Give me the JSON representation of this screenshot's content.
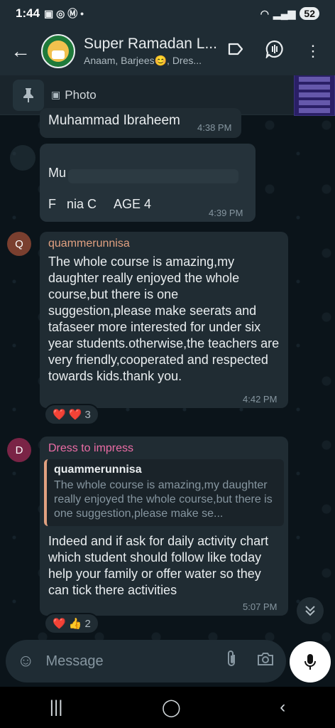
{
  "status_bar": {
    "time": "1:44",
    "battery": "52"
  },
  "header": {
    "title": "Super Ramadan L...",
    "subtitle": "Anaam, Barjees😊, Dres..."
  },
  "pinned": {
    "label": "Photo"
  },
  "messages": [
    {
      "text": "Muhammad Ibraheem",
      "time": "4:38 PM"
    },
    {
      "line1": "Mu",
      "line2": "F   nia C     AGE 4",
      "time": "4:39 PM"
    },
    {
      "avatar_letter": "Q",
      "sender": "quammerunnisa",
      "text": "The whole course is amazing,my daughter really enjoyed the whole course,but there is one suggestion,please make seerats and tafaseer more interested for under six year students.otherwise,the teachers are very friendly,cooperated and respected towards kids.thank you.",
      "time": "4:42 PM",
      "reactions": {
        "emojis": "❤️ ❤️",
        "count": "3"
      }
    },
    {
      "avatar_letter": "D",
      "sender": "Dress to impress",
      "quote_author": "quammerunnisa",
      "quote_text": "The whole course is amazing,my daughter really enjoyed the whole course,but there is one suggestion,please make se...",
      "text": "Indeed and if ask for daily activity chart which student should follow like today help your family or offer water so they can tick there activities",
      "time": "5:07 PM",
      "reactions": {
        "emojis": "❤️ 👍",
        "count": "2"
      }
    }
  ],
  "composer": {
    "placeholder": "Message"
  },
  "colors": {
    "sender_q": "#e0a080",
    "sender_d": "#ec6da6",
    "avatar_q": "#7a3f2f",
    "avatar_d": "#7a2446"
  }
}
